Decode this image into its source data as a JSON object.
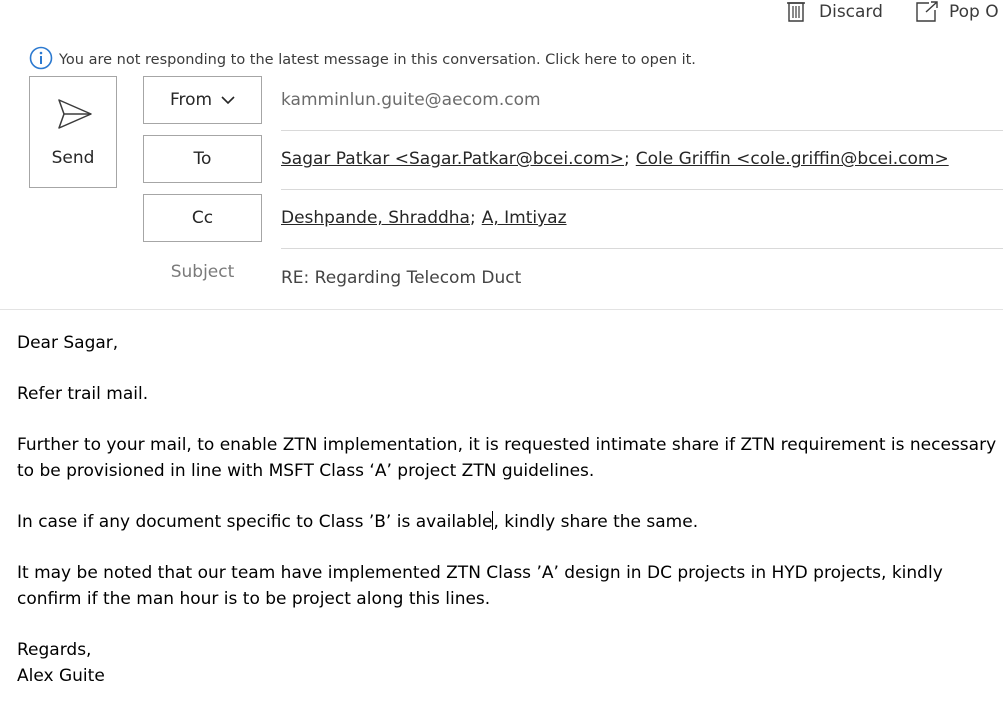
{
  "toolbar": {
    "discard_label": "Discard",
    "popout_label": "Pop O",
    "discard_icon": "trash-icon",
    "popout_icon": "pop-out-icon"
  },
  "info_bar": {
    "icon": "info-icon",
    "text": "You are not responding to the latest message in this conversation. Click here to open it."
  },
  "send": {
    "label": "Send",
    "icon": "send-icon"
  },
  "header": {
    "from": {
      "label": "From",
      "value": "kamminlun.guite@aecom.com"
    },
    "to": {
      "label": "To",
      "recipients": [
        "Sagar Patkar <Sagar.Patkar@bcei.com>",
        "Cole Griffin <cole.griffin@bcei.com>"
      ],
      "separator": ";"
    },
    "cc": {
      "label": "Cc",
      "recipients": [
        "Deshpande, Shraddha",
        "A, Imtiyaz"
      ],
      "separator": ";"
    },
    "subject": {
      "label": "Subject",
      "value": "RE: Regarding Telecom Duct"
    }
  },
  "body": {
    "greeting": "Dear Sagar,",
    "p1": "Refer trail mail.",
    "p2": "Further to your mail, to enable ZTN implementation, it is requested intimate share if ZTN requirement is necessary to be provisioned in line with MSFT Class ‘A’ project ZTN guidelines.",
    "p3_before_cursor": "In case if any document specific to Class ’B’ is available",
    "p3_after_cursor": ", kindly share the same.",
    "p4": "It may be noted that our team have implemented ZTN Class ’A’ design in DC projects in HYD projects, kindly confirm if the man hour is to be project along this lines.",
    "signoff": "Regards,",
    "signature": "Alex Guite"
  },
  "colors": {
    "info_icon": "#2b79d0",
    "border": "#a6a6a6",
    "divider": "#d9d9d9"
  }
}
